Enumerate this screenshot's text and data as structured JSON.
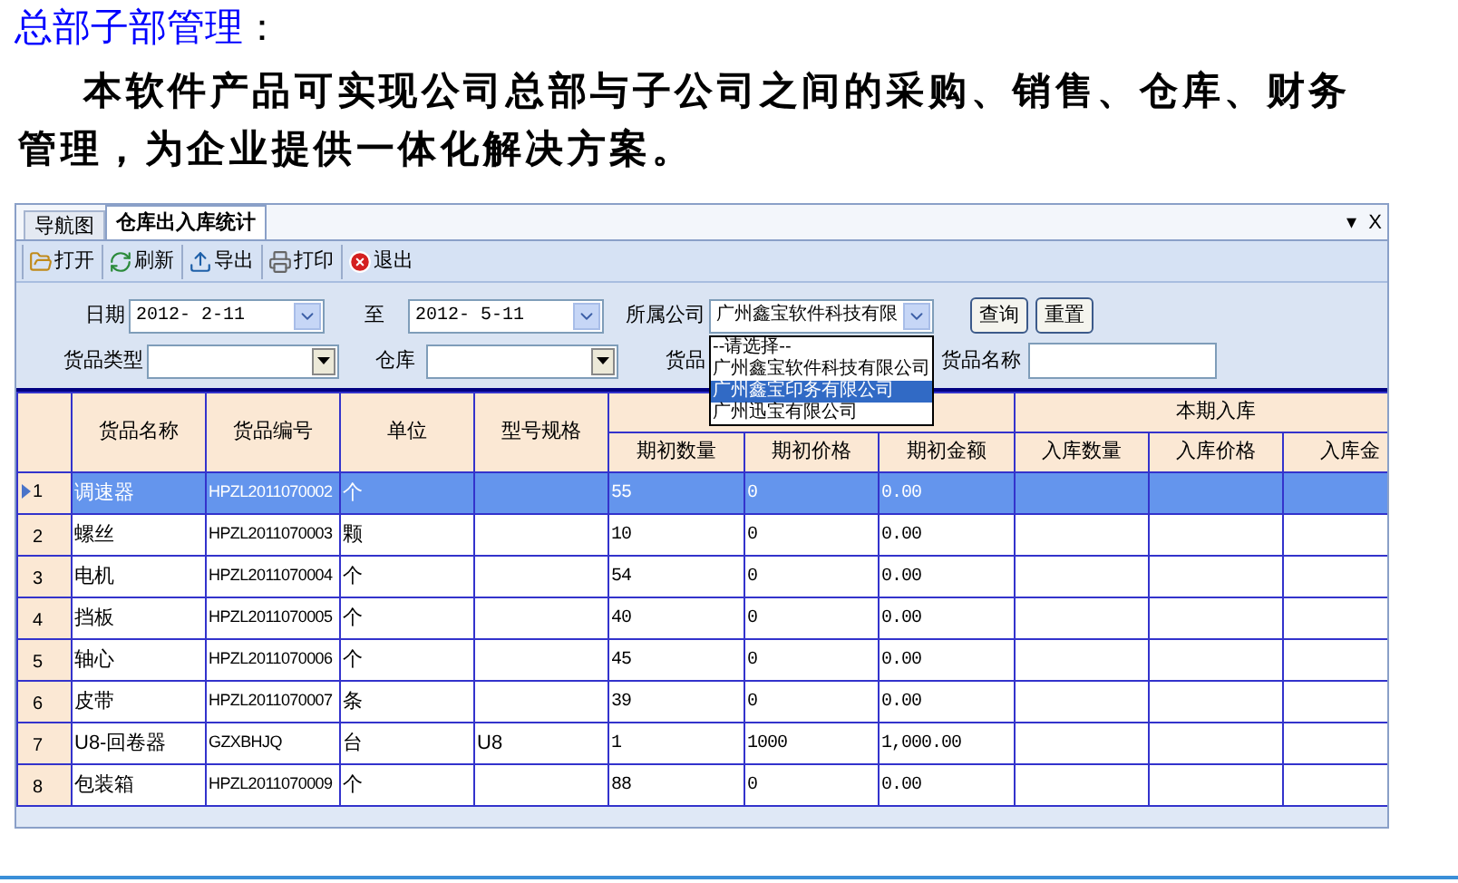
{
  "heading": {
    "text": "总部子部管理",
    "suffix": "："
  },
  "intro": "本软件产品可实现公司总部与子公司之间的采购、销售、仓库、财务管理，为企业提供一体化解决方案。",
  "app": {
    "tabs": [
      {
        "label": "导航图",
        "selected": false
      },
      {
        "label": "仓库出入库统计",
        "selected": true
      }
    ],
    "window_controls": [
      "▾",
      "X"
    ],
    "toolbar": [
      {
        "kind": "open",
        "label": "打开"
      },
      {
        "kind": "refresh",
        "label": "刷新"
      },
      {
        "kind": "export",
        "label": "导出"
      },
      {
        "kind": "print",
        "label": "打印"
      },
      {
        "kind": "exit",
        "label": "退出"
      }
    ],
    "filters": {
      "date_label": "日期",
      "date_from": "2012- 2-11",
      "to_label": "至",
      "date_to": "2012- 5-11",
      "company_label": "所属公司",
      "company_value": "广州鑫宝软件科技有限",
      "company_options": [
        {
          "label": "--请选择--",
          "selected": false
        },
        {
          "label": "广州鑫宝软件科技有限公司",
          "selected": false
        },
        {
          "label": "广州鑫宝印务有限公司",
          "selected": true
        },
        {
          "label": "广州迅宝有限公司",
          "selected": false
        }
      ],
      "buttons": [
        "查询",
        "重置"
      ],
      "type_label": "货品类型",
      "warehouse_label": "仓库",
      "goods_label": "货品",
      "goods_name_label": "货品名称"
    },
    "table": {
      "group_header": "本期入库",
      "columns": [
        "货品名称",
        "货品编号",
        "单位",
        "型号规格",
        "期初数量",
        "期初价格",
        "期初金额",
        "入库数量",
        "入库价格",
        "入库金"
      ],
      "rows": [
        {
          "selected": true,
          "number": "1",
          "cells": [
            "调速器",
            "HPZL2011070002",
            "个",
            "",
            "55",
            "0",
            "0.00",
            "",
            "",
            ""
          ]
        },
        {
          "selected": false,
          "number": "2",
          "cells": [
            "螺丝",
            "HPZL2011070003",
            "颗",
            "",
            "10",
            "0",
            "0.00",
            "",
            "",
            ""
          ]
        },
        {
          "selected": false,
          "number": "3",
          "cells": [
            "电机",
            "HPZL2011070004",
            "个",
            "",
            "54",
            "0",
            "0.00",
            "",
            "",
            ""
          ]
        },
        {
          "selected": false,
          "number": "4",
          "cells": [
            "挡板",
            "HPZL2011070005",
            "个",
            "",
            "40",
            "0",
            "0.00",
            "",
            "",
            ""
          ]
        },
        {
          "selected": false,
          "number": "5",
          "cells": [
            "轴心",
            "HPZL2011070006",
            "个",
            "",
            "45",
            "0",
            "0.00",
            "",
            "",
            ""
          ]
        },
        {
          "selected": false,
          "number": "6",
          "cells": [
            "皮带",
            "HPZL2011070007",
            "条",
            "",
            "39",
            "0",
            "0.00",
            "",
            "",
            ""
          ]
        },
        {
          "selected": false,
          "number": "7",
          "cells": [
            "U8-回卷器",
            "GZXBHJQ",
            "台",
            "U8",
            "1",
            "1000",
            "1,000.00",
            "",
            "",
            ""
          ]
        },
        {
          "selected": false,
          "number": "8",
          "cells": [
            "包装箱",
            "HPZL2011070009",
            "个",
            "",
            "88",
            "0",
            "0.00",
            "",
            "",
            ""
          ]
        }
      ]
    }
  }
}
